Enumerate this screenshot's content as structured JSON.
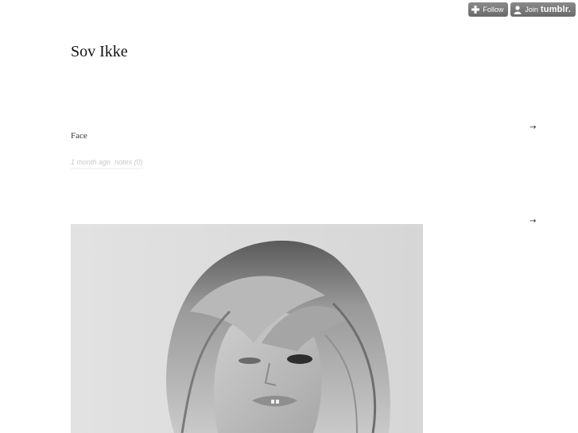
{
  "tumblr_controls": {
    "follow_label": "Follow",
    "join_label": "Join",
    "join_brand": "tumblr."
  },
  "blog": {
    "title": "Sov Ikke"
  },
  "posts": [
    {
      "type": "text",
      "body": "Face",
      "meta": {
        "time_ago": "1 month ago",
        "notes": "notes (0)"
      },
      "permalink_symbol": "→"
    },
    {
      "type": "photo",
      "permalink_symbol": "→",
      "image_description_icon": "photo-portrait-bw"
    }
  ],
  "colors": {
    "control_bg": "#7b7b7b",
    "meta_text": "#c8c8c8",
    "title_text": "#111111"
  }
}
